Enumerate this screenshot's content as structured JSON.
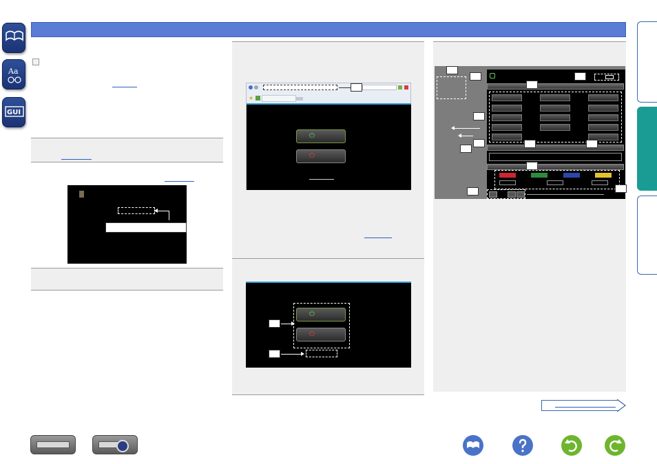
{
  "icons": {
    "manual": "book-icon",
    "glossary": "glossary-icon",
    "gui": "GUI",
    "note": "pencil-icon"
  },
  "colors": {
    "header": "#5a7cd6",
    "tab_active": "#1a9c94",
    "link": "#2a5fc0",
    "red_button": "#d0262f",
    "green_button": "#2f8a3c",
    "blue_button": "#2d47a8",
    "yellow_button": "#e6c22a"
  },
  "bottom_nav": [
    "receiver-front-icon",
    "receiver-remote-icon",
    "book-icon",
    "help-icon",
    "back-icon",
    "forward-icon"
  ]
}
